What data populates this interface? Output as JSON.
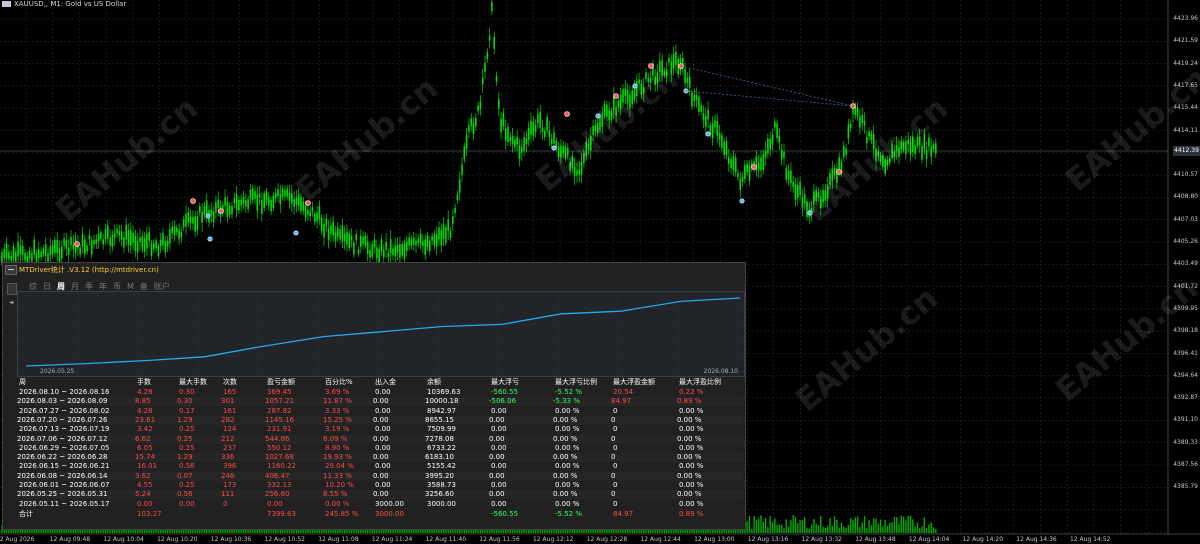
{
  "chart": {
    "title": "XAUUSD,, M1:  Gold vs US Dollar",
    "current_price": "4412.39",
    "price_labels": [
      "4423.96",
      "4421.59",
      "4419.24",
      "4417.65",
      "4415.44",
      "4414.11",
      "4412.34",
      "4410.57",
      "4408.80",
      "4407.03",
      "4405.26",
      "4403.49",
      "4401.72",
      "4399.95",
      "4398.18",
      "4396.41",
      "4394.64",
      "4392.87",
      "4391.10",
      "4389.33",
      "4387.56",
      "4385.79"
    ],
    "time_labels": [
      "12 Aug 2026",
      "12 Aug 09:48",
      "12 Aug 10:04",
      "12 Aug 10:20",
      "12 Aug 10:36",
      "12 Aug 10:52",
      "12 Aug 11:08",
      "12 Aug 11:24",
      "12 Aug 11:40",
      "12 Aug 11:56",
      "12 Aug 12:12",
      "12 Aug 12:28",
      "12 Aug 12:44",
      "12 Aug 13:00",
      "12 Aug 13:16",
      "12 Aug 13:32",
      "12 Aug 13:48",
      "12 Aug 14:04",
      "12 Aug 14:20",
      "12 Aug 14:36",
      "12 Aug 14:52"
    ],
    "watermark": "EAHub.cn",
    "colors": {
      "bull": "#00e000",
      "grid": "#2a2a2a",
      "volume": "#00b000"
    }
  },
  "panel": {
    "title": "MTDriver统计 .V3.12 (http://mtdriver.cn)",
    "tabs": [
      "综",
      "日",
      "周",
      "月",
      "季",
      "年",
      "币",
      "M",
      "备",
      "账户"
    ],
    "active_tab": "周",
    "equity": {
      "start_date": "2026.05.25",
      "end_date": "2026.08.10",
      "points": [
        3000,
        3256,
        3589,
        4000,
        5155,
        6183,
        6733,
        7278,
        7510,
        8655,
        8943,
        10000,
        10370
      ]
    },
    "headers": [
      "周",
      "手数",
      "最大手数",
      "次数",
      "盈亏金额",
      "百分比%",
      "出入金",
      "余额",
      "最大浮亏",
      "最大浮亏比例",
      "最大浮盈金额",
      "最大浮盈比例"
    ],
    "rows": [
      [
        "2026.08.10 ~ 2026.08.16",
        "4.28",
        "0.30",
        "165",
        "369.45",
        "3.69 %",
        "0.00",
        "10369.63",
        "-560.55",
        "-5.52 %",
        "20.54",
        "0.22 %"
      ],
      [
        "2026.08.03 ~ 2026.08.09",
        "8.85",
        "0.30",
        "301",
        "1057.21",
        "11.87 %",
        "0.00",
        "10000.18",
        "-506.06",
        "-5.33 %",
        "84.97",
        "0.89 %"
      ],
      [
        "2026.07.27 ~ 2026.08.02",
        "4.28",
        "0.17",
        "161",
        "287.82",
        "3.33 %",
        "0.00",
        "8942.97",
        "0.00",
        "0.00 %",
        "0",
        "0.00 %"
      ],
      [
        "2026.07.20 ~ 2026.07.26",
        "23.61",
        "1.29",
        "282",
        "1145.16",
        "15.25 %",
        "0.00",
        "8655.15",
        "0.00",
        "0.00 %",
        "0",
        "0.00 %"
      ],
      [
        "2026.07.13 ~ 2026.07.19",
        "3.42",
        "0.25",
        "124",
        "231.91",
        "3.19 %",
        "0.00",
        "7509.99",
        "0.00",
        "0.00 %",
        "0",
        "0.00 %"
      ],
      [
        "2026.07.06 ~ 2026.07.12",
        "6.62",
        "0.25",
        "212",
        "544.86",
        "8.09 %",
        "0.00",
        "7278.08",
        "0.00",
        "0.00 %",
        "0",
        "0.00 %"
      ],
      [
        "2026.06.29 ~ 2026.07.05",
        "6.05",
        "0.25",
        "237",
        "550.12",
        "8.90 %",
        "0.00",
        "6733.22",
        "0.00",
        "0.00 %",
        "0",
        "0.00 %"
      ],
      [
        "2026.06.22 ~ 2026.06.28",
        "15.74",
        "1.29",
        "336",
        "1027.68",
        "19.93 %",
        "0.00",
        "6183.10",
        "0.00",
        "0.00 %",
        "0",
        "0.00 %"
      ],
      [
        "2026.06.15 ~ 2026.06.21",
        "16.01",
        "0.56",
        "396",
        "1160.22",
        "29.04 %",
        "0.00",
        "5155.42",
        "0.00",
        "0.00 %",
        "0",
        "0.00 %"
      ],
      [
        "2026.06.08 ~ 2026.06.14",
        "3.62",
        "0.07",
        "248",
        "406.47",
        "11.33 %",
        "0.00",
        "3995.20",
        "0.00",
        "0.00 %",
        "0",
        "0.00 %"
      ],
      [
        "2026.06.01 ~ 2026.06.07",
        "4.55",
        "0.25",
        "173",
        "332.13",
        "10.20 %",
        "0.00",
        "3588.73",
        "0.00",
        "0.00 %",
        "0",
        "0.00 %"
      ],
      [
        "2026.05.25 ~ 2026.05.31",
        "5.24",
        "0.56",
        "111",
        "256.60",
        "8.55 %",
        "0.00",
        "3256.60",
        "0.00",
        "0.00 %",
        "0",
        "0.00 %"
      ],
      [
        "2026.05.11 ~ 2026.05.17",
        "0.00",
        "0.00",
        "0",
        "0.00",
        "0.00 %",
        "3000.00",
        "3000.00",
        "0.00",
        "0.00 %",
        "0",
        "0.00 %"
      ]
    ],
    "total": [
      "合计",
      "103.27",
      "",
      "",
      "7399.63",
      "245.85 %",
      "3000.00",
      "",
      "-560.55",
      "-5.52 %",
      "84.97",
      "0.89 %"
    ]
  }
}
